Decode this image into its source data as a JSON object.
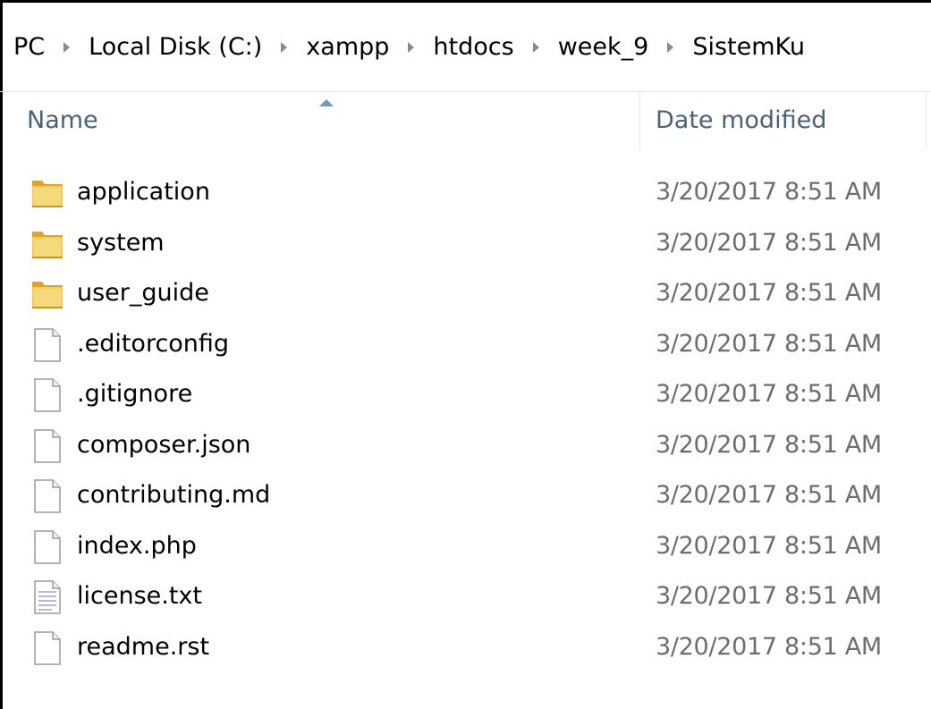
{
  "breadcrumb": [
    "PC",
    "Local Disk (C:)",
    "xampp",
    "htdocs",
    "week_9",
    "SistemKu"
  ],
  "columns": {
    "name": "Name",
    "date_modified": "Date modified"
  },
  "files": [
    {
      "name": "application",
      "date": "3/20/2017 8:51 AM",
      "icon": "folder-icon"
    },
    {
      "name": "system",
      "date": "3/20/2017 8:51 AM",
      "icon": "folder-icon"
    },
    {
      "name": "user_guide",
      "date": "3/20/2017 8:51 AM",
      "icon": "folder-icon"
    },
    {
      "name": ".editorconfig",
      "date": "3/20/2017 8:51 AM",
      "icon": "file-icon"
    },
    {
      "name": ".gitignore",
      "date": "3/20/2017 8:51 AM",
      "icon": "file-icon"
    },
    {
      "name": "composer.json",
      "date": "3/20/2017 8:51 AM",
      "icon": "file-icon"
    },
    {
      "name": "contributing.md",
      "date": "3/20/2017 8:51 AM",
      "icon": "file-icon"
    },
    {
      "name": "index.php",
      "date": "3/20/2017 8:51 AM",
      "icon": "file-icon"
    },
    {
      "name": "license.txt",
      "date": "3/20/2017 8:51 AM",
      "icon": "text-file-icon"
    },
    {
      "name": "readme.rst",
      "date": "3/20/2017 8:51 AM",
      "icon": "file-icon"
    }
  ],
  "colors": {
    "folder": "#e8b93a",
    "header_text": "#4c607a",
    "date_text": "#6d6d6d"
  }
}
